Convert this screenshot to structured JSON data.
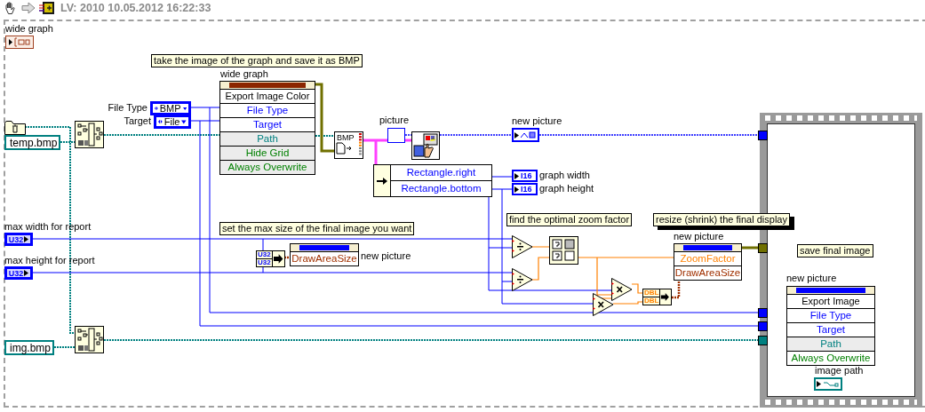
{
  "toolbar": {
    "version_stamp": "LV: 2010 10.05.2012 16:22:33"
  },
  "graph_reference": {
    "label": "wide graph"
  },
  "comments": [
    {
      "text": "take the image of the graph and save it as BMP",
      "shadow": false
    },
    {
      "text": "set the max size of the final image you want",
      "shadow": false
    },
    {
      "text": "find the optimal zoom factor",
      "shadow": false
    },
    {
      "text": "resize (shrink) the final display",
      "shadow": true
    },
    {
      "text": "save final image",
      "shadow": false
    }
  ],
  "enum_constants": [
    {
      "label": "File Type",
      "value": "BMP"
    },
    {
      "label": "Target",
      "value": "File"
    }
  ],
  "path_constants": [
    {
      "value": "temp.bmp"
    },
    {
      "value": "img.bmp"
    }
  ],
  "numeric_controls": [
    {
      "label": "max width for report",
      "type": "U32"
    },
    {
      "label": "max height for report",
      "type": "U32"
    }
  ],
  "property_nodes": [
    {
      "label": "wide graph",
      "kind": "graph",
      "method": "Export Image Color",
      "properties": [
        {
          "name": "File Type",
          "kind": "enum",
          "optional": false
        },
        {
          "name": "Target",
          "kind": "enum",
          "optional": false
        },
        {
          "name": "Path",
          "kind": "path",
          "optional": true
        },
        {
          "name": "Hide Grid",
          "kind": "boolean",
          "optional": true
        },
        {
          "name": "Always Overwrite",
          "kind": "boolean",
          "optional": true
        }
      ]
    },
    {
      "label": "new picture",
      "kind": "picture",
      "properties": [
        {
          "name": "DrawAreaSize",
          "kind": "cluster",
          "optional": false
        }
      ]
    },
    {
      "label": "new picture",
      "kind": "picture",
      "properties": [
        {
          "name": "ZoomFactor",
          "kind": "dbl",
          "optional": false
        },
        {
          "name": "DrawAreaSize",
          "kind": "cluster",
          "optional": false
        }
      ]
    },
    {
      "label": "new picture",
      "kind": "picture",
      "method": "Export Image",
      "properties": [
        {
          "name": "File Type",
          "kind": "enum",
          "optional": false
        },
        {
          "name": "Target",
          "kind": "enum",
          "optional": false
        },
        {
          "name": "Path",
          "kind": "path",
          "optional": true
        },
        {
          "name": "Always Overwrite",
          "kind": "boolean",
          "optional": false
        }
      ]
    }
  ],
  "bmp_node": {
    "format": "BMP"
  },
  "picture_constant": {
    "label": "picture"
  },
  "unbundle": {
    "elements": [
      "Rectangle.right",
      "Rectangle.bottom"
    ]
  },
  "indicators": [
    {
      "kind": "picture",
      "label": "new picture"
    },
    {
      "kind": "numeric",
      "label": "graph width",
      "type": "I16"
    },
    {
      "kind": "numeric",
      "label": "graph height",
      "type": "I16"
    },
    {
      "kind": "path",
      "label": "image path"
    }
  ],
  "bundles": [
    {
      "inputs": [
        "U32",
        "U32"
      ]
    },
    {
      "inputs": [
        "DBL",
        "DBL"
      ]
    }
  ]
}
